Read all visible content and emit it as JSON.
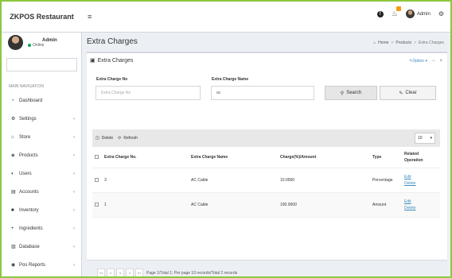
{
  "app": {
    "brand": "ZKPOS Restaurant"
  },
  "header": {
    "menu_icon": "hamburger-icon",
    "info_icon": "info-icon",
    "bell_icon": "bell-icon",
    "notification_badge": "",
    "user_name": "Admin",
    "settings_icon": "gear-icon"
  },
  "sidebar": {
    "user_name": "Admin",
    "user_status": "Online",
    "nav_header": "MAIN NAVIGATION",
    "items": [
      {
        "label": "Dashboard",
        "icon": "dashboard-icon",
        "glyph": "◔",
        "arrow": ""
      },
      {
        "label": "Settings",
        "icon": "gear-icon",
        "glyph": "⚙",
        "arrow": "‹"
      },
      {
        "label": "Store",
        "icon": "home-icon",
        "glyph": "⌂",
        "arrow": "‹"
      },
      {
        "label": "Products",
        "icon": "tag-icon",
        "glyph": "◈",
        "arrow": "‹"
      },
      {
        "label": "Users",
        "icon": "user-icon",
        "glyph": "◐",
        "arrow": "‹"
      },
      {
        "label": "Accounts",
        "icon": "ledger-icon",
        "glyph": "▤",
        "arrow": "‹"
      },
      {
        "label": "Inventory",
        "icon": "truck-icon",
        "glyph": "■",
        "arrow": "‹"
      },
      {
        "label": "Ingredients",
        "icon": "plus-icon",
        "glyph": "+",
        "arrow": "‹"
      },
      {
        "label": "Database",
        "icon": "database-icon",
        "glyph": "▥",
        "arrow": "‹"
      },
      {
        "label": "Pos Reports",
        "icon": "eye-icon",
        "glyph": "◉",
        "arrow": "‹"
      }
    ]
  },
  "page": {
    "title": "Extra Charges",
    "breadcrumb": [
      "Home",
      "Products",
      "Extra Charges"
    ]
  },
  "box": {
    "title": "Extra Charges",
    "options_label": "Option",
    "minimize": "−",
    "close": "×"
  },
  "filters": {
    "no_label": "Extra Charge No",
    "no_placeholder": "Extra Charge No",
    "name_label": "Extra Charge Name",
    "name_value": "ac",
    "search_label": "Search",
    "clear_label": "Clear"
  },
  "toolbar": {
    "delete_label": "Delete",
    "refresh_label": "Refresh",
    "page_size": "10"
  },
  "table": {
    "columns": [
      "Extra Charge No.",
      "Extra Charge Name",
      "Charge(%)/Amount",
      "Type",
      "Related Operation"
    ],
    "rows": [
      {
        "no": "3",
        "name": "AC Cable",
        "charge": "10.0000",
        "type": "Percentage",
        "edit": "Edit",
        "delete": "Delete"
      },
      {
        "no": "1",
        "name": "AC Cable",
        "charge": "100.0000",
        "type": "Amount",
        "edit": "Edit",
        "delete": "Delete"
      }
    ]
  },
  "pager": {
    "first": "<<",
    "prev": "<",
    "current": "1",
    "next": ">",
    "last": ">>",
    "info": "Page 1/Total 1; Per page 10 records/Total 2 records"
  }
}
